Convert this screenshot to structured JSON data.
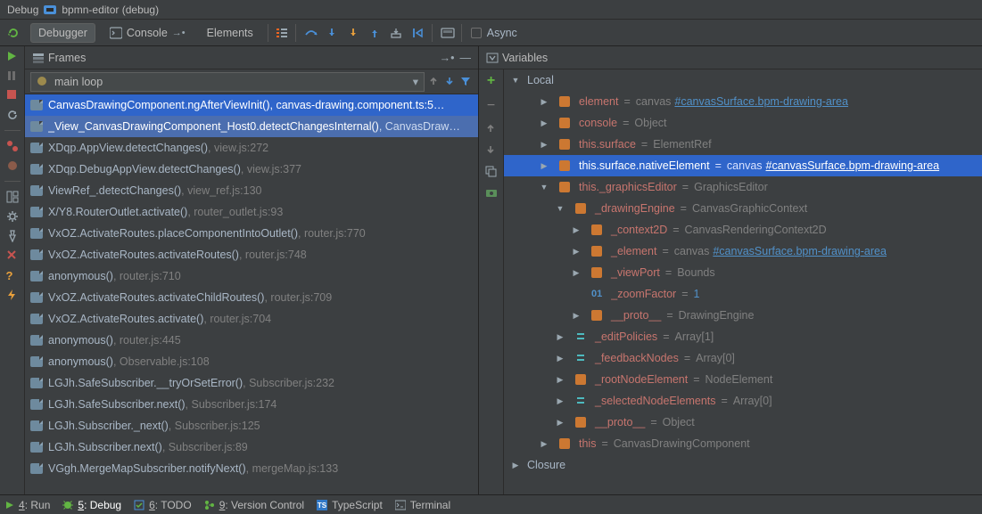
{
  "title": {
    "prefix": "Debug",
    "config": "bpmn-editor (debug)"
  },
  "tabs": {
    "debugger": "Debugger",
    "console": "Console",
    "elements": "Elements",
    "async": "Async"
  },
  "frames": {
    "header": "Frames",
    "thread": "main loop",
    "items": [
      {
        "fn": "CanvasDrawingComponent.ngAfterViewInit()",
        "loc": "canvas-drawing.component.ts:5…",
        "sel": "sel"
      },
      {
        "fn": "_View_CanvasDrawingComponent_Host0.detectChangesInternal()",
        "loc": "CanvasDraw…",
        "sel": "run"
      },
      {
        "fn": "XDqp.AppView.detectChanges()",
        "loc": "view.js:272"
      },
      {
        "fn": "XDqp.DebugAppView.detectChanges()",
        "loc": "view.js:377"
      },
      {
        "fn": "ViewRef_.detectChanges()",
        "loc": "view_ref.js:130"
      },
      {
        "fn": "X/Y8.RouterOutlet.activate()",
        "loc": "router_outlet.js:93"
      },
      {
        "fn": "VxOZ.ActivateRoutes.placeComponentIntoOutlet()",
        "loc": "router.js:770"
      },
      {
        "fn": "VxOZ.ActivateRoutes.activateRoutes()",
        "loc": "router.js:748"
      },
      {
        "fn": "anonymous()",
        "loc": "router.js:710"
      },
      {
        "fn": "VxOZ.ActivateRoutes.activateChildRoutes()",
        "loc": "router.js:709"
      },
      {
        "fn": "VxOZ.ActivateRoutes.activate()",
        "loc": "router.js:704"
      },
      {
        "fn": "anonymous()",
        "loc": "router.js:445"
      },
      {
        "fn": "anonymous()",
        "loc": "Observable.js:108"
      },
      {
        "fn": "LGJh.SafeSubscriber.__tryOrSetError()",
        "loc": "Subscriber.js:232"
      },
      {
        "fn": "LGJh.SafeSubscriber.next()",
        "loc": "Subscriber.js:174"
      },
      {
        "fn": "LGJh.Subscriber._next()",
        "loc": "Subscriber.js:125"
      },
      {
        "fn": "LGJh.Subscriber.next()",
        "loc": "Subscriber.js:89"
      },
      {
        "fn": "VGgh.MergeMapSubscriber.notifyNext()",
        "loc": "mergeMap.js:133"
      }
    ]
  },
  "vars": {
    "header": "Variables",
    "local": "Local",
    "closure": "Closure",
    "rows": [
      {
        "indent": 2,
        "tw": "r",
        "ic": "o",
        "name": "element",
        "eq": " = ",
        "pre": "canvas",
        "link": "#canvasSurface.bpm-drawing-area"
      },
      {
        "indent": 2,
        "tw": "r",
        "ic": "o",
        "name": "console",
        "eq": " = ",
        "val": "Object"
      },
      {
        "indent": 2,
        "tw": "r",
        "ic": "o",
        "name": "this.surface",
        "eq": " = ",
        "val": "ElementRef"
      },
      {
        "indent": 2,
        "tw": "r",
        "ic": "o",
        "name": "this.surface.nativeElement",
        "eq": " = ",
        "pre": "canvas",
        "link": "#canvasSurface.bpm-drawing-area",
        "sel": true
      },
      {
        "indent": 2,
        "tw": "d",
        "ic": "o",
        "name": "this._graphicsEditor",
        "eq": " = ",
        "val": "GraphicsEditor"
      },
      {
        "indent": 3,
        "tw": "d",
        "ic": "o",
        "name": "_drawingEngine",
        "eq": " = ",
        "val": "CanvasGraphicContext"
      },
      {
        "indent": 4,
        "tw": "r",
        "ic": "o",
        "name": "_context2D",
        "eq": " = ",
        "val": "CanvasRenderingContext2D"
      },
      {
        "indent": 4,
        "tw": "r",
        "ic": "o",
        "name": "_element",
        "eq": " = ",
        "pre": "canvas",
        "link": "#canvasSurface.bpm-drawing-area"
      },
      {
        "indent": 4,
        "tw": "r",
        "ic": "o",
        "name": "_viewPort",
        "eq": " = ",
        "val": "Bounds"
      },
      {
        "indent": 4,
        "tw": "n",
        "ic": "n",
        "name": "_zoomFactor",
        "eq": " = ",
        "blue": "1"
      },
      {
        "indent": 4,
        "tw": "r",
        "ic": "o",
        "name": "__proto__",
        "eq": " = ",
        "val": "DrawingEngine"
      },
      {
        "indent": 3,
        "tw": "r",
        "ic": "a",
        "name": "_editPolicies",
        "eq": " = ",
        "val": "Array[1]"
      },
      {
        "indent": 3,
        "tw": "r",
        "ic": "a",
        "name": "_feedbackNodes",
        "eq": " = ",
        "val": "Array[0]"
      },
      {
        "indent": 3,
        "tw": "r",
        "ic": "o",
        "name": "_rootNodeElement",
        "eq": " = ",
        "val": "NodeElement"
      },
      {
        "indent": 3,
        "tw": "r",
        "ic": "a",
        "name": "_selectedNodeElements",
        "eq": " = ",
        "val": "Array[0]"
      },
      {
        "indent": 3,
        "tw": "r",
        "ic": "o",
        "name": "__proto__",
        "eq": " = ",
        "val": "Object"
      },
      {
        "indent": 2,
        "tw": "r",
        "ic": "o",
        "name": "this",
        "eq": " = ",
        "val": "CanvasDrawingComponent"
      }
    ]
  },
  "status": {
    "run": "4: Run",
    "run_u": "4",
    "debug": "5: Debug",
    "debug_u": "5",
    "todo": "6: TODO",
    "todo_u": "6",
    "vcs": "9: Version Control",
    "vcs_u": "9",
    "ts": "TypeScript",
    "terminal": "Terminal"
  }
}
